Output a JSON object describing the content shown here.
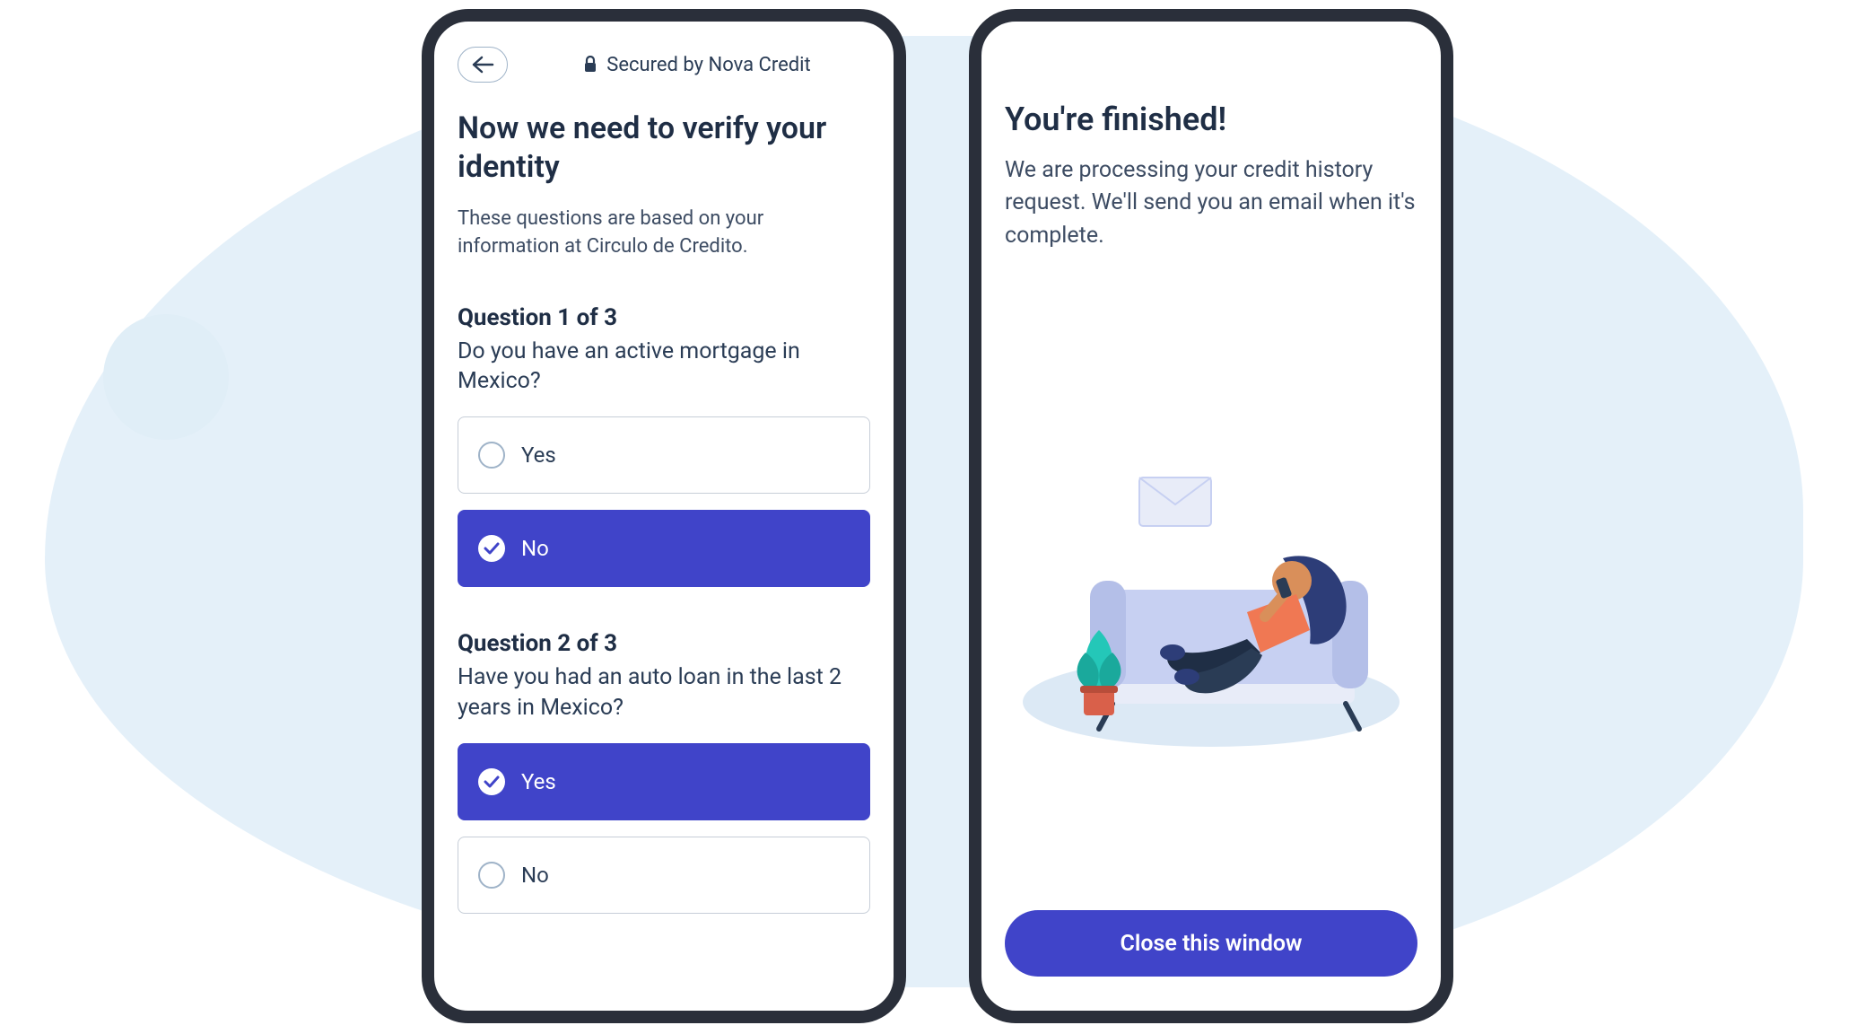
{
  "screen1": {
    "secured_label": "Secured by Nova Credit",
    "title": "Now we need to verify your identity",
    "subtitle": "These questions are based on your information at Circulo de Credito.",
    "questions": [
      {
        "label": "Question 1 of 3",
        "text": "Do you have an active mortgage in Mexico?",
        "options": [
          {
            "label": "Yes",
            "selected": false
          },
          {
            "label": "No",
            "selected": true
          }
        ]
      },
      {
        "label": "Question 2 of 3",
        "text": "Have you had an auto loan in the last 2 years in Mexico?",
        "options": [
          {
            "label": "Yes",
            "selected": true
          },
          {
            "label": "No",
            "selected": false
          }
        ]
      }
    ]
  },
  "screen2": {
    "title": "You're finished!",
    "subtitle": "We are processing your credit history request. We'll send you an email when it's complete.",
    "close_label": "Close this window"
  },
  "colors": {
    "accent": "#4044c9",
    "bg_blob": "#e4f0f9",
    "text_dark": "#1f2e45"
  }
}
